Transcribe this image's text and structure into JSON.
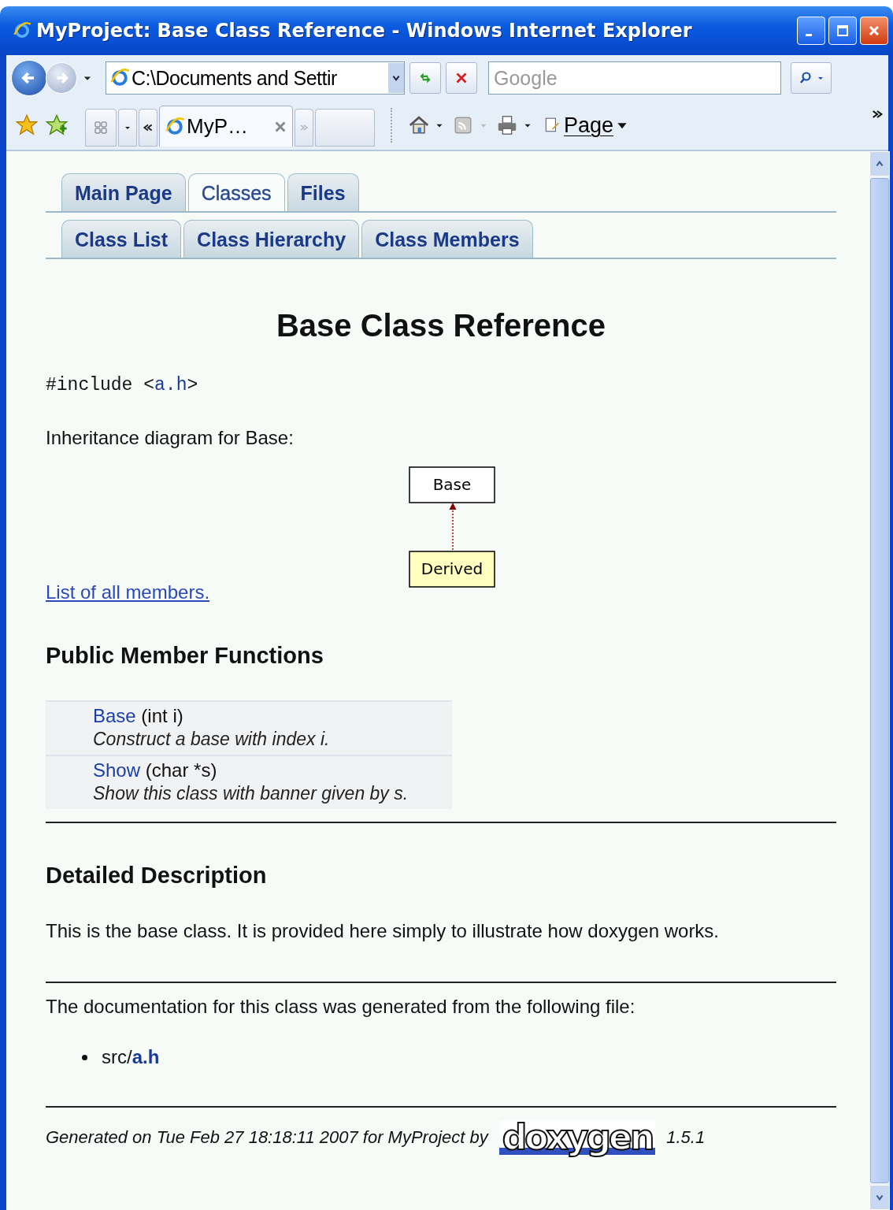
{
  "window": {
    "title": "MyProject: Base Class Reference - Windows Internet Explorer"
  },
  "address_bar": {
    "value": "C:\\Documents and Settir"
  },
  "search": {
    "placeholder": "Google"
  },
  "browser_tab": {
    "label": "MyP…"
  },
  "toolbar": {
    "page_menu": "Page"
  },
  "nav_tabs": [
    {
      "label": "Main Page",
      "selected": false
    },
    {
      "label": "Classes",
      "selected": true
    },
    {
      "label": "Files",
      "selected": false
    }
  ],
  "sub_tabs": [
    {
      "label": "Class List",
      "selected": false
    },
    {
      "label": "Class Hierarchy",
      "selected": false
    },
    {
      "label": "Class Members",
      "selected": false
    }
  ],
  "heading": "Base Class Reference",
  "include": {
    "prefix": "#include <",
    "file": "a.h",
    "suffix": ">"
  },
  "inheritance_caption": "Inheritance diagram for Base:",
  "diagram": {
    "nodes": [
      {
        "label": "Base",
        "kind": "base"
      },
      {
        "label": "Derived",
        "kind": "derived"
      }
    ]
  },
  "members_link": "List of all members.",
  "public_functions": {
    "title": "Public Member Functions",
    "items": [
      {
        "name": "Base",
        "args": "(int i)",
        "brief": "Construct a base with index i."
      },
      {
        "name": "Show",
        "args": "(char *s)",
        "brief": "Show this class with banner given by s."
      }
    ]
  },
  "detailed": {
    "title": "Detailed Description",
    "text": "This is the base class. It is provided here simply to illustrate how doxygen works."
  },
  "files": {
    "caption": "The documentation for this class was generated from the following file:",
    "items": [
      {
        "dir": "src/",
        "file": "a.h"
      }
    ]
  },
  "footer": {
    "text": "Generated on Tue Feb 27 18:18:11 2007 for MyProject by",
    "logo": "doxygen",
    "version": "1.5.1"
  }
}
